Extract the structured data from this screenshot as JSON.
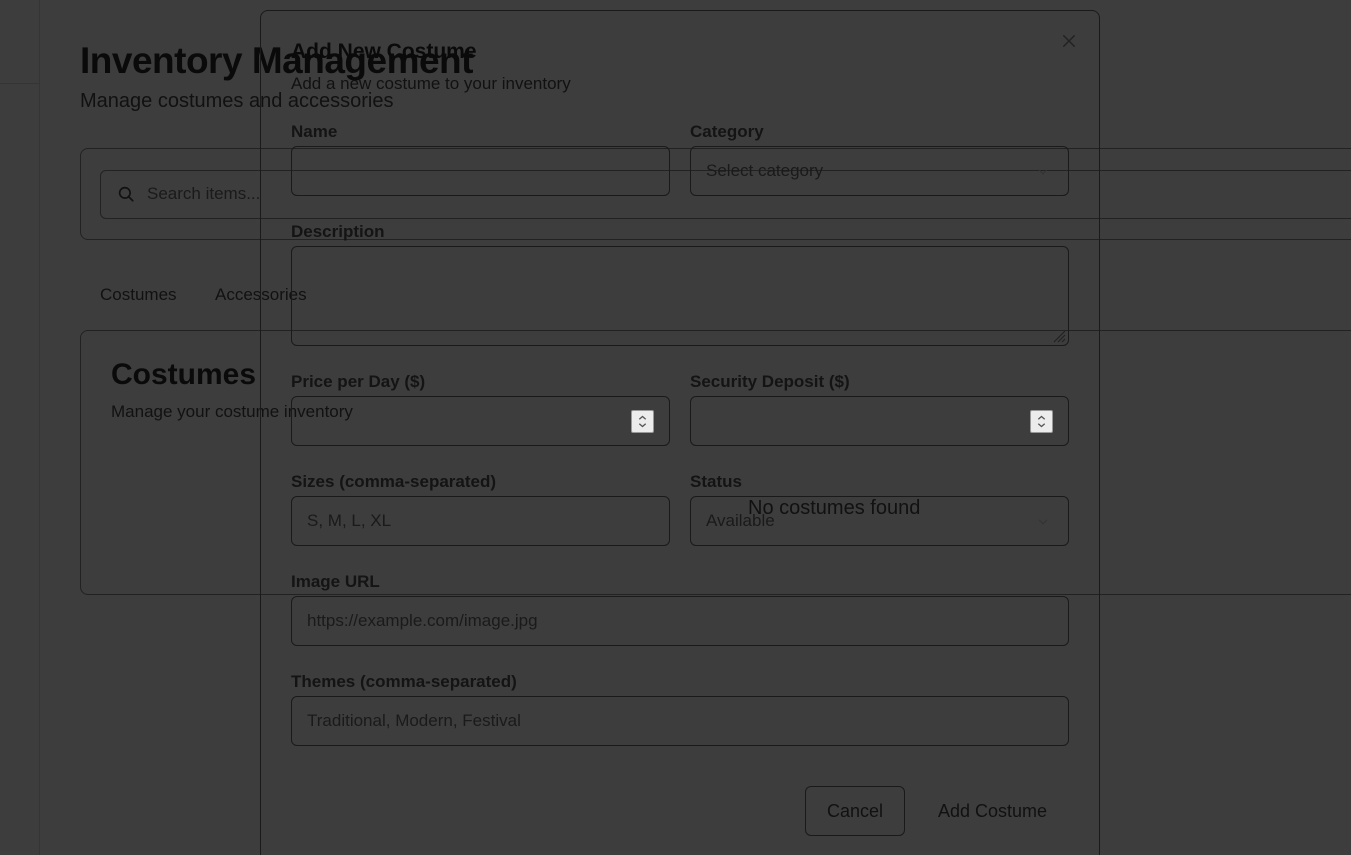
{
  "page": {
    "title": "Inventory Management",
    "subtitle": "Manage costumes and accessories"
  },
  "search": {
    "placeholder": "Search items..."
  },
  "tabs": [
    {
      "label": "Costumes"
    },
    {
      "label": "Accessories"
    }
  ],
  "section": {
    "title": "Costumes",
    "subtitle": "Manage your costume inventory",
    "empty_text": "No costumes found"
  },
  "modal": {
    "title": "Add New Costume",
    "description": "Add a new costume to your inventory",
    "fields": {
      "name": {
        "label": "Name",
        "value": ""
      },
      "category": {
        "label": "Category",
        "value": "Select category"
      },
      "description": {
        "label": "Description",
        "value": ""
      },
      "price": {
        "label": "Price per Day ($)",
        "value": ""
      },
      "deposit": {
        "label": "Security Deposit ($)",
        "value": ""
      },
      "sizes": {
        "label": "Sizes (comma-separated)",
        "placeholder": "S, M, L, XL"
      },
      "status": {
        "label": "Status",
        "value": "Available"
      },
      "image_url": {
        "label": "Image URL",
        "placeholder": "https://example.com/image.jpg"
      },
      "themes": {
        "label": "Themes (comma-separated)",
        "placeholder": "Traditional, Modern, Festival"
      }
    },
    "cancel_label": "Cancel",
    "submit_label": "Add Costume"
  },
  "colors": {
    "overlay": "#3d3d3d",
    "text": "#111111",
    "border": "#1a1a1a"
  }
}
